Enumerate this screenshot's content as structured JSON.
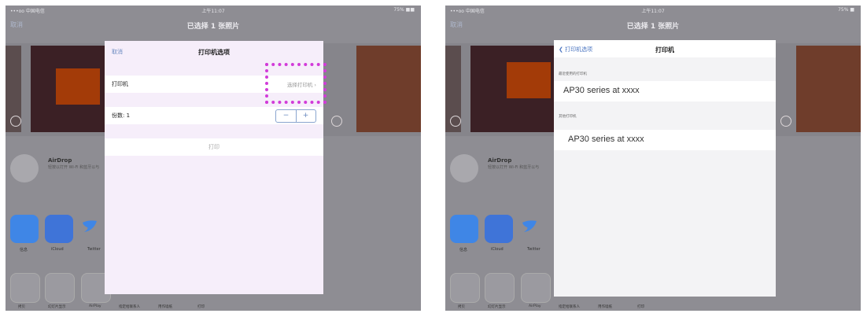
{
  "left": {
    "status": {
      "carrier": "•••oo 中国电信 ",
      "time": "上午11:07",
      "battery": "75% ■■"
    },
    "topbar": {
      "cancel": "取消",
      "title": "已选择 1 张照片"
    },
    "airdrop": {
      "title": "AirDrop",
      "subtitle": "轻按以打开 Wi-Fi 和蓝牙以与"
    },
    "apps": [
      {
        "label": "信息"
      },
      {
        "label": "iCloud"
      },
      {
        "label": "Twitter"
      }
    ],
    "actions": [
      {
        "label": "拷贝"
      },
      {
        "label": "幻灯片显示"
      },
      {
        "label": "AirPlay"
      },
      {
        "label": "指定给联系人"
      },
      {
        "label": "用作墙纸"
      },
      {
        "label": "打印"
      }
    ],
    "dialog": {
      "cancel": "取消",
      "title": "打印机选项",
      "printer_label": "打印机",
      "printer_value": "选择打印机 ›",
      "copies_label": "份数: 1",
      "stepper_minus": "−",
      "stepper_plus": "+",
      "print_button": "打印"
    }
  },
  "right": {
    "status": {
      "carrier": "•••oo 中国电信 ",
      "time": "上午11:07",
      "battery": "75% ■"
    },
    "topbar": {
      "cancel": "取消",
      "title": "已选择 1 张照片"
    },
    "airdrop": {
      "title": "AirDrop",
      "subtitle": "轻按以打开 Wi-Fi 和蓝牙以与"
    },
    "apps": [
      {
        "label": "信息"
      },
      {
        "label": "iCloud"
      },
      {
        "label": "Twitter"
      }
    ],
    "actions": [
      {
        "label": "拷贝"
      },
      {
        "label": "幻灯片显示"
      },
      {
        "label": "AirPlay"
      },
      {
        "label": "指定给联系人"
      },
      {
        "label": "用作墙纸"
      },
      {
        "label": "打印"
      }
    ],
    "dialog": {
      "back": "❮ 打印机选项",
      "title": "打印机",
      "recent_section": "最近使用的打印机",
      "recent_printer": "AP30 series at xxxx",
      "other_section": "其他打印机",
      "other_printer": "AP30 series at xxxx"
    }
  },
  "colors": {
    "highlight": "#d23bd9",
    "accent": "#6a8ac0",
    "orange_block": "#a33b08"
  }
}
